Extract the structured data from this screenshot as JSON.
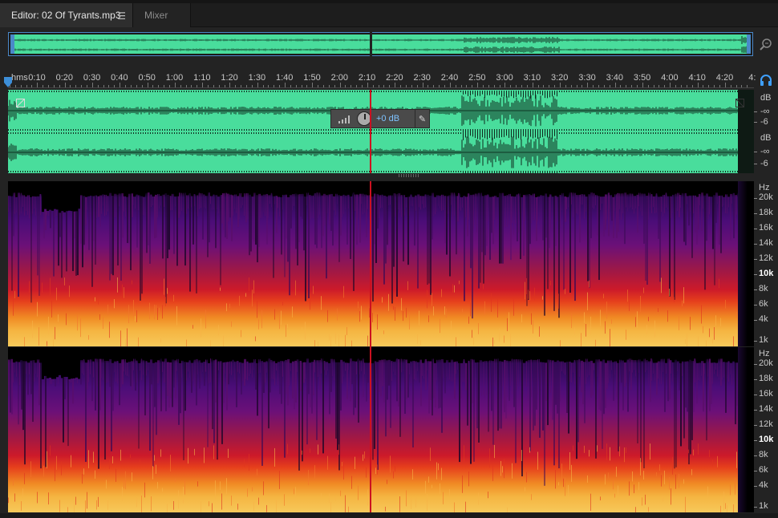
{
  "tabs": {
    "editor_label": "Editor: 02 Of Tyrants.mp3",
    "mixer_label": "Mixer"
  },
  "ruler": {
    "unit": "hms",
    "labels": [
      "0:10",
      "0:20",
      "0:30",
      "0:40",
      "0:50",
      "1:00",
      "1:10",
      "1:20",
      "1:30",
      "1:40",
      "1:50",
      "2:00",
      "2:10",
      "2:20",
      "2:30",
      "2:40",
      "2:50",
      "3:00",
      "3:10",
      "3:20",
      "3:30",
      "3:40",
      "3:50",
      "4:00",
      "4:10",
      "4:20",
      "4:"
    ]
  },
  "hud": {
    "value": "+0 dB"
  },
  "db_scale": {
    "ch1": {
      "unit": "dB",
      "inf": "-∞",
      "six": "-6"
    },
    "ch2": {
      "unit": "dB",
      "inf": "-∞",
      "six": "-6"
    }
  },
  "hz_scale": {
    "unit": "Hz",
    "labels": [
      "20k",
      "18k",
      "16k",
      "14k",
      "12k",
      "10k",
      "8k",
      "6k",
      "4k",
      "1k"
    ]
  },
  "colors": {
    "waveform": "#49dd9c",
    "playhead": "#cc1020",
    "selection_border": "#4a88c8"
  },
  "icons": {
    "menu": "hamburger-menu-icon",
    "zoom": "zoom-icon",
    "headphone": "headphone-icon",
    "pin": "pin-icon"
  }
}
